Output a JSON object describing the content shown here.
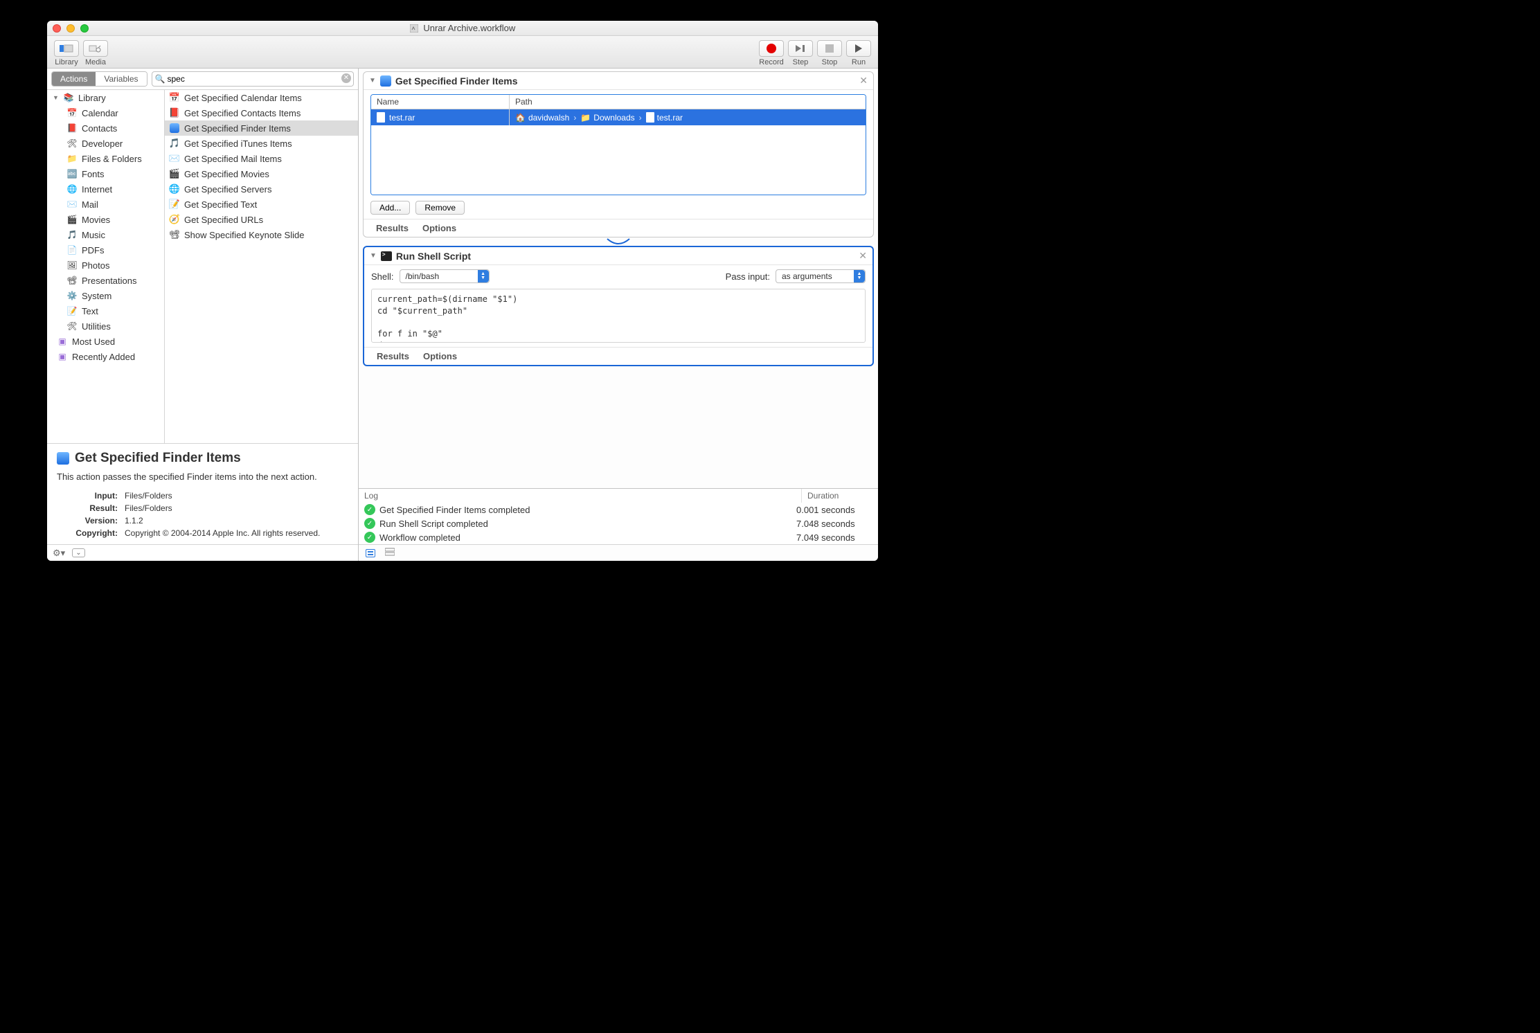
{
  "window": {
    "title": "Unrar Archive.workflow"
  },
  "toolbar": {
    "library": "Library",
    "media": "Media",
    "record": "Record",
    "step": "Step",
    "stop": "Stop",
    "run": "Run"
  },
  "leftTabs": {
    "actions": "Actions",
    "variables": "Variables"
  },
  "search": {
    "value": "spec"
  },
  "library": {
    "root": "Library",
    "categories": [
      "Calendar",
      "Contacts",
      "Developer",
      "Files & Folders",
      "Fonts",
      "Internet",
      "Mail",
      "Movies",
      "Music",
      "PDFs",
      "Photos",
      "Presentations",
      "System",
      "Text",
      "Utilities"
    ],
    "smart": [
      "Most Used",
      "Recently Added"
    ]
  },
  "actions": [
    "Get Specified Calendar Items",
    "Get Specified Contacts Items",
    "Get Specified Finder Items",
    "Get Specified iTunes Items",
    "Get Specified Mail Items",
    "Get Specified Movies",
    "Get Specified Servers",
    "Get Specified Text",
    "Get Specified URLs",
    "Show Specified Keynote Slide"
  ],
  "selectedActionIndex": 2,
  "description": {
    "title": "Get Specified Finder Items",
    "summary": "This action passes the specified Finder items into the next action.",
    "input_label": "Input:",
    "input": "Files/Folders",
    "result_label": "Result:",
    "result": "Files/Folders",
    "version_label": "Version:",
    "version": "1.1.2",
    "copyright_label": "Copyright:",
    "copyright": "Copyright © 2004-2014 Apple Inc.  All rights reserved."
  },
  "workflow": {
    "action1": {
      "title": "Get Specified Finder Items",
      "cols": {
        "name": "Name",
        "path": "Path"
      },
      "item": {
        "name": "test.rar",
        "path": [
          "davidwalsh",
          "Downloads",
          "test.rar"
        ]
      },
      "add": "Add...",
      "remove": "Remove",
      "results": "Results",
      "options": "Options"
    },
    "action2": {
      "title": "Run Shell Script",
      "shell_label": "Shell:",
      "shell": "/bin/bash",
      "pass_label": "Pass input:",
      "pass": "as arguments",
      "code": "current_path=$(dirname \"$1\")\ncd \"$current_path\"\n\nfor f in \"$@\"\ndo",
      "results": "Results",
      "options": "Options"
    }
  },
  "log": {
    "headers": {
      "log": "Log",
      "duration": "Duration"
    },
    "rows": [
      {
        "msg": "Get Specified Finder Items completed",
        "dur": "0.001 seconds"
      },
      {
        "msg": "Run Shell Script completed",
        "dur": "7.048 seconds"
      },
      {
        "msg": "Workflow completed",
        "dur": "7.049 seconds"
      }
    ]
  }
}
